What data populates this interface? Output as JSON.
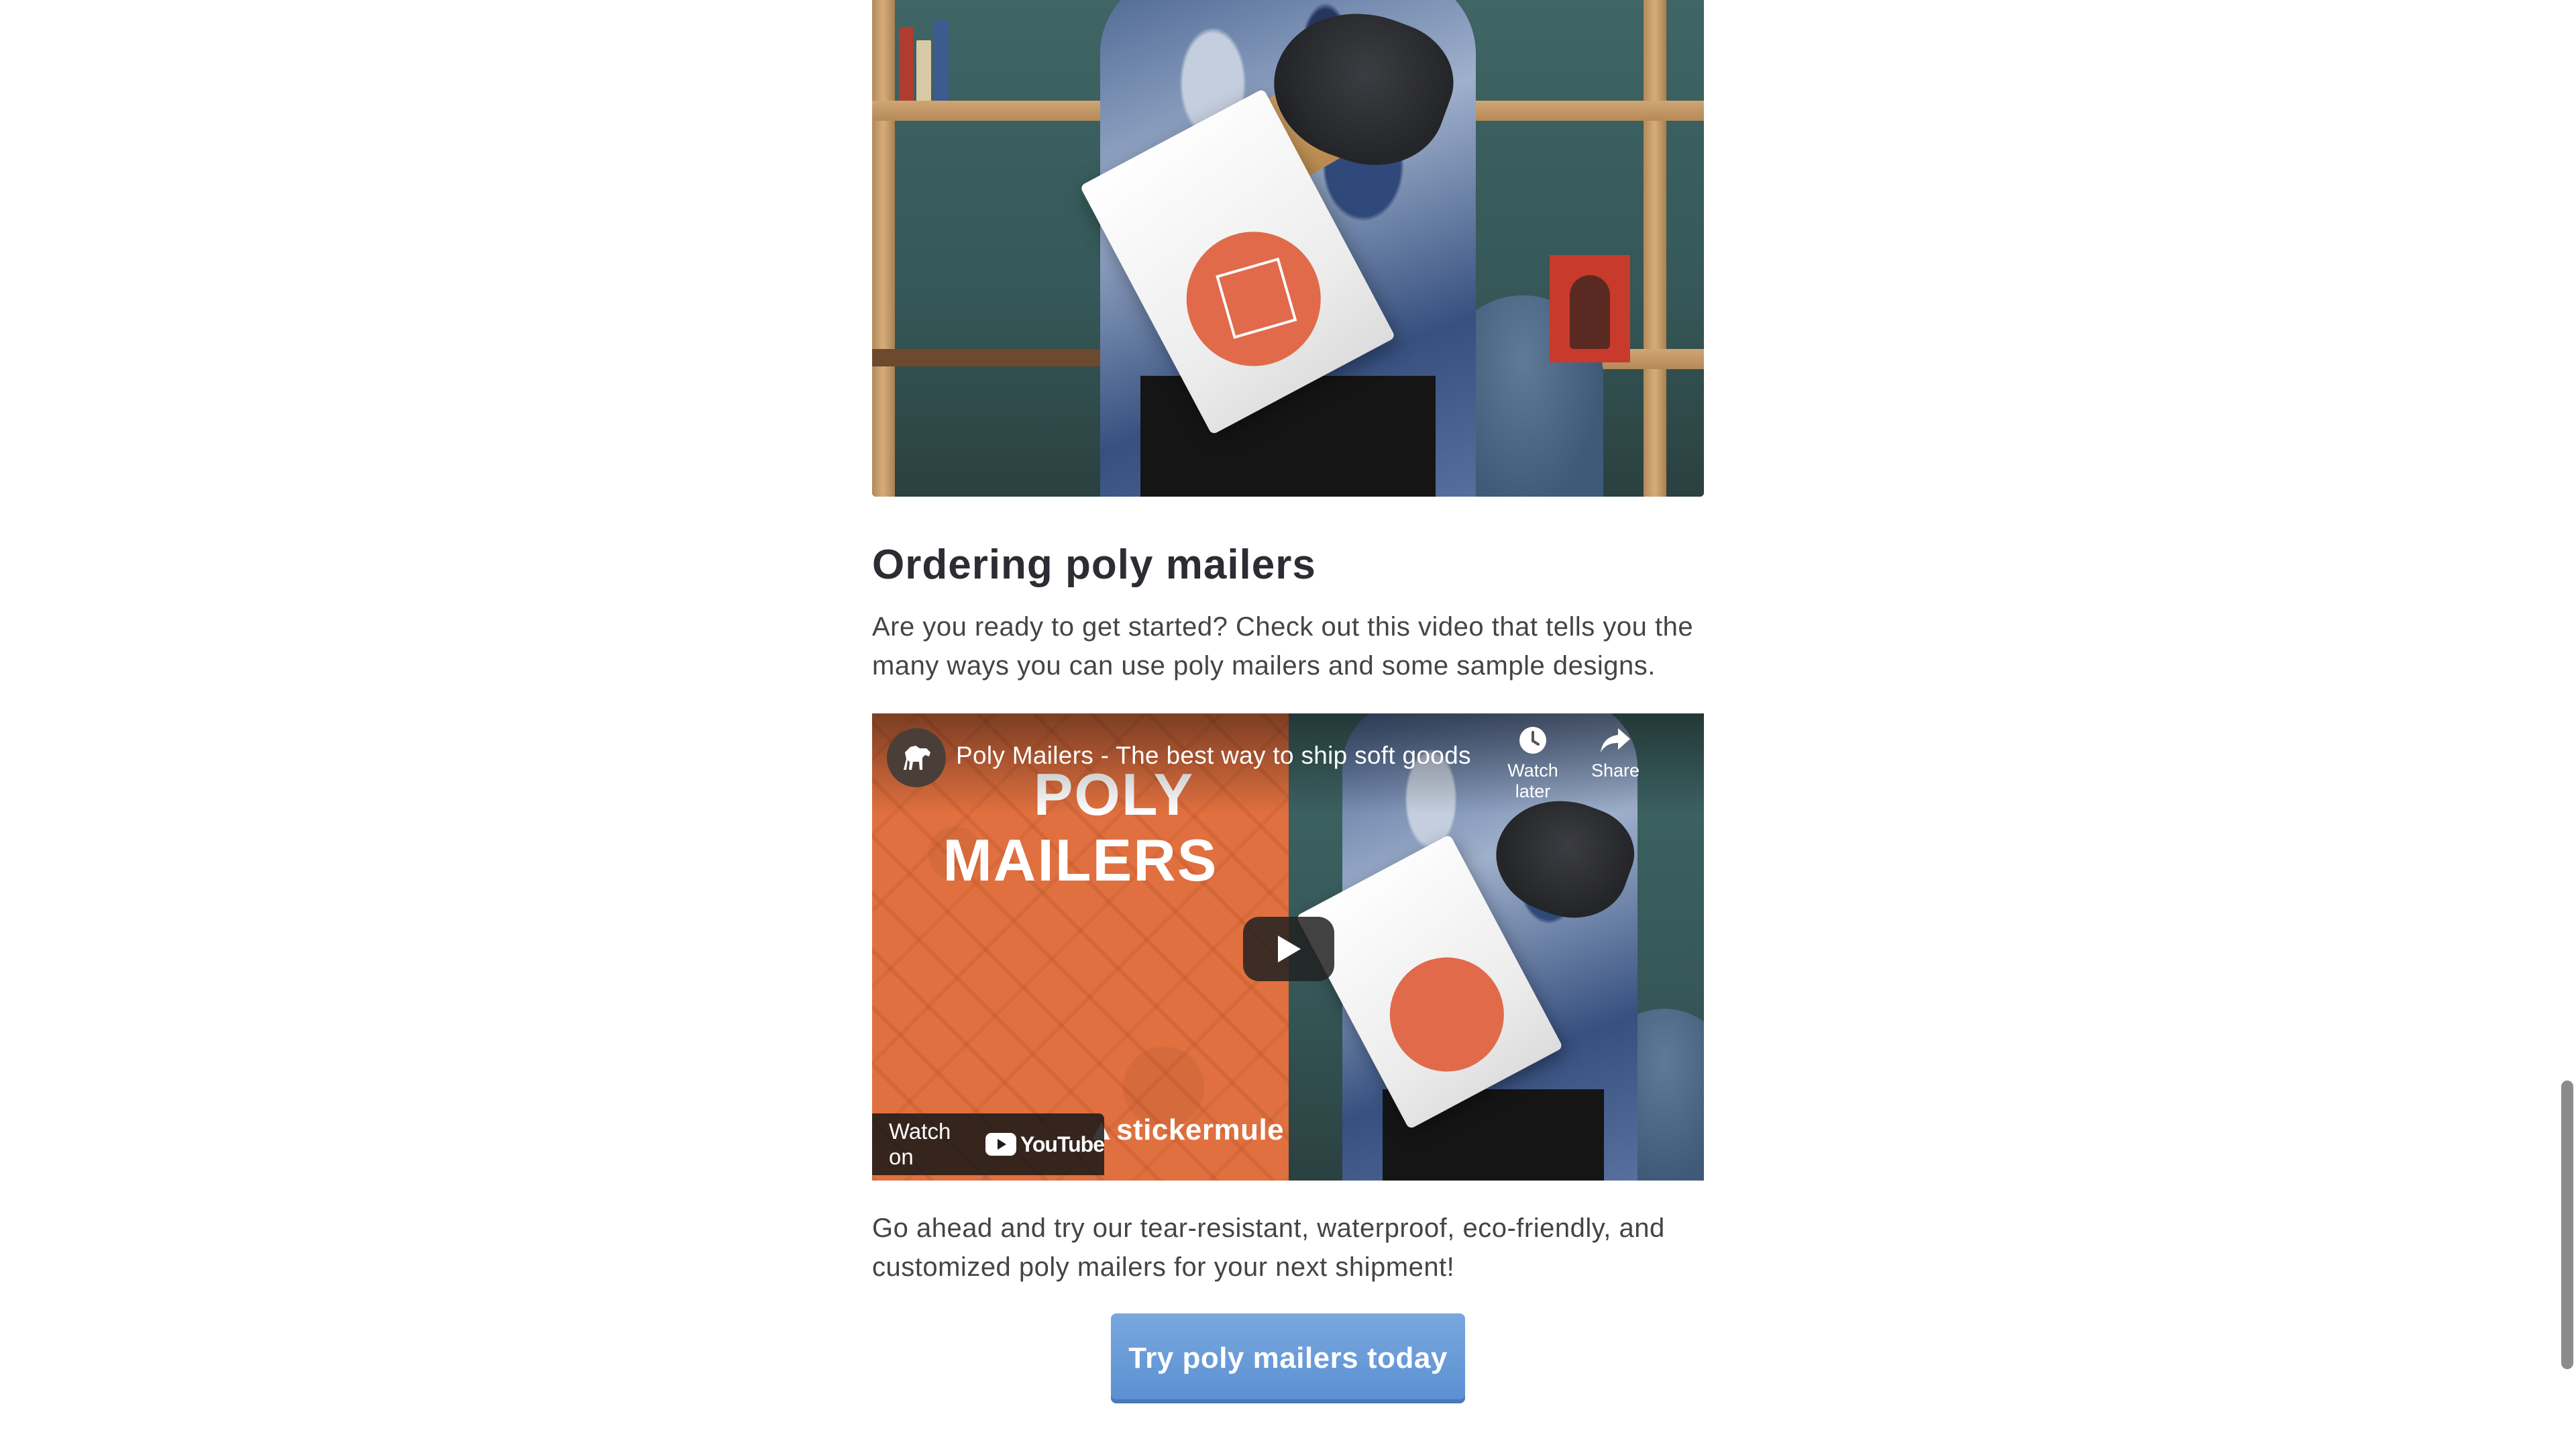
{
  "article": {
    "heading": "Ordering poly mailers",
    "intro": "Are you ready to get started? Check out this video that tells you the many ways you can use poly mailers and some sample designs.",
    "closing": "Go ahead and try our tear-resistant, waterproof, eco-friendly, and customized poly mailers for your next shipment!",
    "cta_label": "Try poly mailers today"
  },
  "video": {
    "title": "Poly Mailers - The best way to ship soft goods",
    "thumbnail_line1": "POLY",
    "thumbnail_line2": "MAILERS",
    "brand": "stickermule",
    "watch_later_label": "Watch later",
    "share_label": "Share",
    "watch_on_label": "Watch on",
    "youtube_word": "YouTube"
  },
  "colors": {
    "heading": "#2c2c33",
    "body_text": "#444448",
    "cta_background": "#6b9dd8",
    "video_orange": "#e0703f"
  },
  "icons": {
    "channel": "horse-icon",
    "watch_later": "clock-icon",
    "share": "share-arrow-icon",
    "play": "play-icon",
    "youtube": "youtube-logo-icon"
  }
}
